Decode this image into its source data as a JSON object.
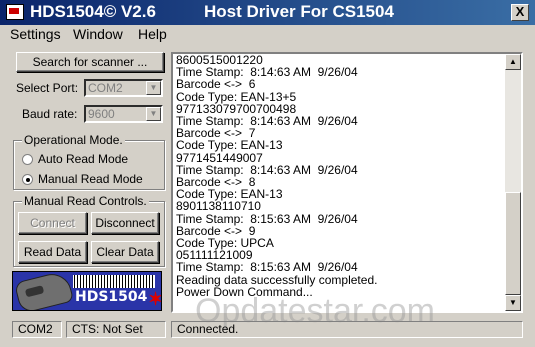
{
  "titlebar": {
    "app_title": "HDS1504© V2.6",
    "window_title": "Host Driver For CS1504",
    "close_label": "X"
  },
  "menu": [
    "Settings",
    "Window",
    "Help"
  ],
  "scanner": {
    "search_button": "Search for scanner ...",
    "select_port_label": "Select Port:",
    "select_port_value": "COM2",
    "baud_rate_label": "Baud rate:",
    "baud_rate_value": "9600"
  },
  "operational_mode": {
    "title": "Operational Mode.",
    "auto_label": "Auto Read Mode",
    "manual_label": "Manual Read Mode",
    "selected": "manual"
  },
  "manual_controls": {
    "title": "Manual Read Controls.",
    "connect": "Connect",
    "disconnect": "Disconnect",
    "read_data": "Read  Data",
    "clear_data": "Clear Data"
  },
  "logo": {
    "text": "HDS1504"
  },
  "log": {
    "lines": [
      "8600515001220",
      "Time Stamp:  8:14:63 AM  9/26/04",
      "Barcode <->  6",
      "Code Type: EAN-13+5",
      "977133079700700498",
      "Time Stamp:  8:14:63 AM  9/26/04",
      "Barcode <->  7",
      "Code Type: EAN-13",
      "9771451449007",
      "Time Stamp:  8:14:63 AM  9/26/04",
      "Barcode <->  8",
      "Code Type: EAN-13",
      "8901138110710",
      "Time Stamp:  8:15:63 AM  9/26/04",
      "Barcode <->  9",
      "Code Type: UPCA",
      "051111121009",
      "Time Stamp:  8:15:63 AM  9/26/04",
      "Reading data successfully completed.",
      "Power Down Command..."
    ]
  },
  "statusbar": {
    "port": "COM2",
    "cts": "CTS: Not Set",
    "status": "Connected."
  },
  "watermark": "Opdatestar.com"
}
